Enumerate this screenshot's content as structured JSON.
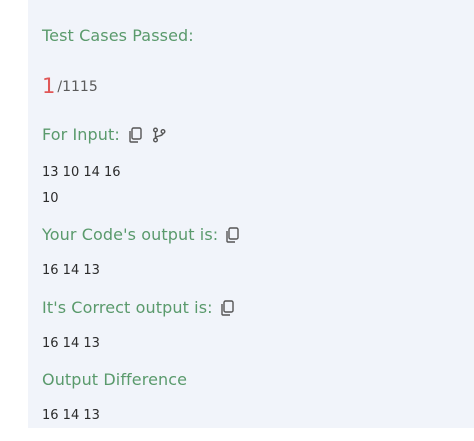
{
  "test_cases": {
    "label": "Test Cases Passed:",
    "passed": "1",
    "total": "/1115"
  },
  "input": {
    "label": "For Input:",
    "icons": [
      "copy-icon",
      "branch-icon"
    ],
    "line1": "13 10 14 16",
    "line2": "10"
  },
  "your_output": {
    "label": "Your Code's output is:",
    "icon": "copy-icon",
    "value": "16 14 13"
  },
  "correct_output": {
    "label": "It's Correct output is:",
    "icon": "copy-icon",
    "value": "16 14 13"
  },
  "difference": {
    "label": "Output Difference",
    "value": "16 14 13"
  },
  "colors": {
    "heading": "#5a9a6c",
    "passed_number": "#e05757",
    "panel_bg": "#f1f4fa"
  }
}
